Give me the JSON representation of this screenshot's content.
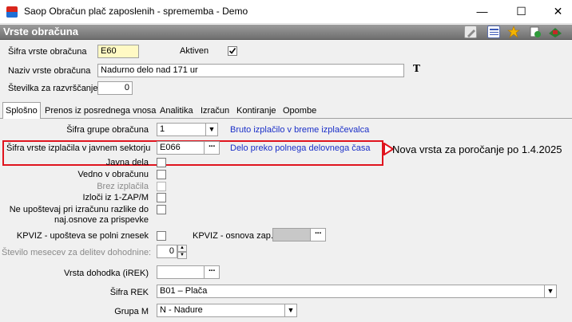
{
  "window": {
    "title": "Saop Obračun plač zaposlenih - sprememba - Demo",
    "minimize_glyph": "—",
    "maximize_glyph": "☐",
    "close_glyph": "✕"
  },
  "section": {
    "title": "Vrste obračuna",
    "toolbar_icons": [
      "edit-icon",
      "table-icon",
      "star-icon",
      "refresh-icon",
      "exit-icon"
    ]
  },
  "header_form": {
    "sifra_label": "Šifra vrste obračuna",
    "sifra_value": "E60",
    "aktiven_label": "Aktiven",
    "aktiven_checked": true,
    "naziv_label": "Naziv vrste obračuna",
    "naziv_value": "Nadurno delo nad 171 ur",
    "font_icon_glyph": "T",
    "stevilka_label": "Številka  za razvrščanje",
    "stevilka_value": "0"
  },
  "tabs": [
    {
      "label": "Splošno",
      "active": true
    },
    {
      "label": "Prenos iz posrednega vnosa",
      "active": false
    },
    {
      "label": "Analitika",
      "active": false
    },
    {
      "label": "Izračun",
      "active": false
    },
    {
      "label": "Kontiranje",
      "active": false
    },
    {
      "label": "Opombe",
      "active": false
    }
  ],
  "general": {
    "skupina_label": "Šifra grupe obračuna",
    "skupina_value": "1",
    "skupina_desc": "Bruto izplačilo v breme izplačevalca",
    "izplacila_label": "Šifra vrste izplačila v javnem sektorju",
    "izplacila_value": "E066",
    "izplacila_desc": "Delo preko polnega delovnega časa",
    "annotation": "Nova vrsta za poročanje po 1.4.2025",
    "javna_label": "Javna dela",
    "vedno_label": "Vedno v obračunu",
    "brez_label": "Brez izplačila",
    "izloci_label": "Izloči iz 1-ZAP/M",
    "neupostevaj_label1": "Ne upoštevaj pri izračunu razlike do",
    "neupostevaj_label2": "naj.osnove za prispevke",
    "kpviz_label": "KPVIZ - upošteva se polni znesek",
    "kpviz_osnova_label": "KPVIZ - osnova zap.",
    "ellipsis": "···",
    "mesecev_label": "Število mesecev za delitev dohodnine:",
    "mesecev_value": "0",
    "dohodka_label": "Vrsta dohodka (iREK)",
    "dohodka_value": "",
    "rek_label": "Šifra REK",
    "rek_value": "B01 – Plača",
    "grupa_label": "Grupa M",
    "grupa_value": "N - Nadure"
  },
  "colors": {
    "section_bar": "#7f7f7f",
    "desc_blue": "#1a2fc8",
    "highlight_red": "#e0141e",
    "code_field_yellow": "#fff9c4"
  }
}
